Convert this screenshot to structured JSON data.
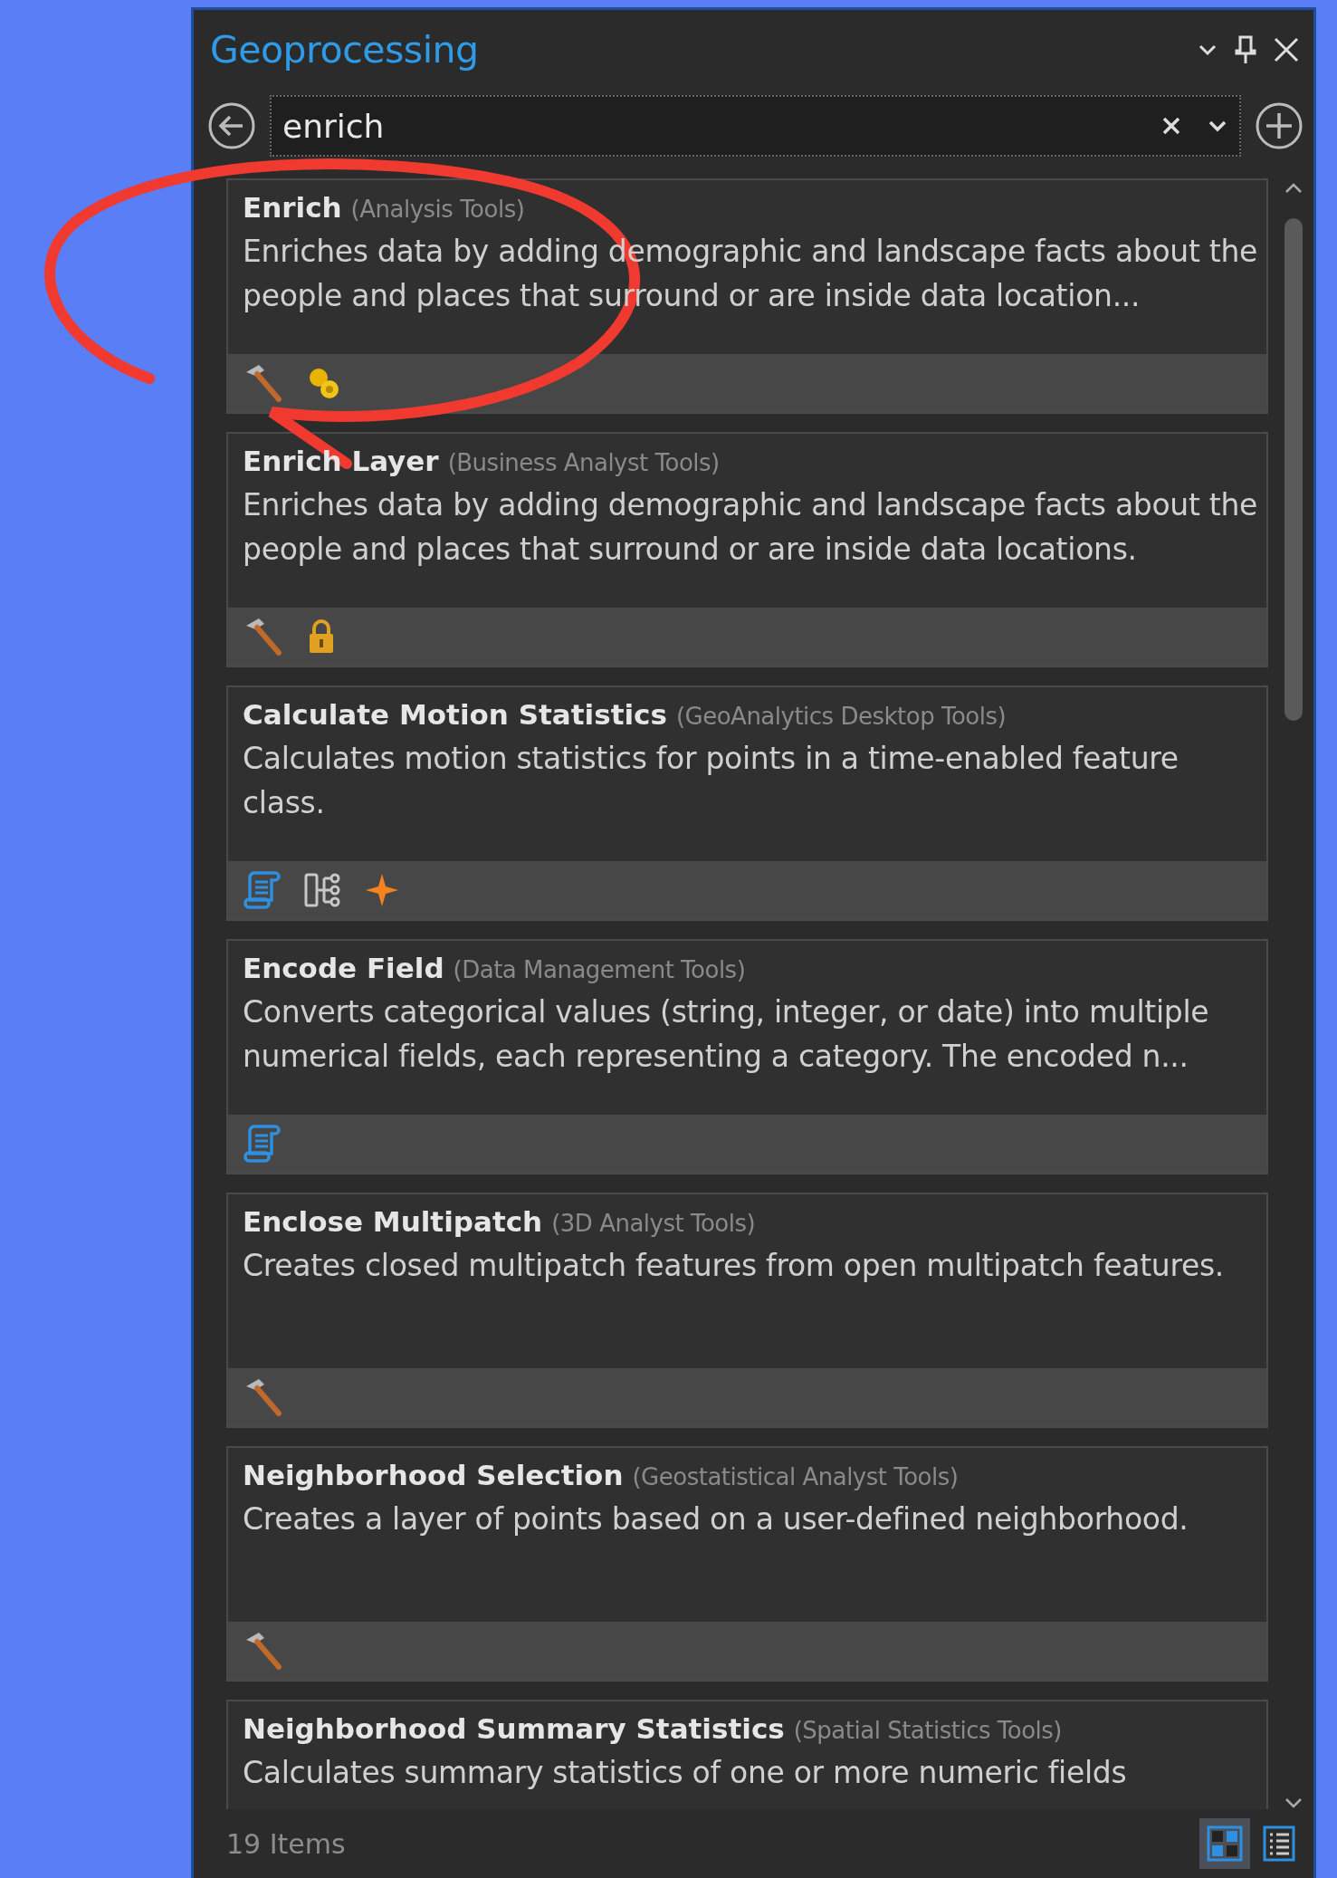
{
  "panel": {
    "title": "Geoprocessing"
  },
  "search": {
    "value": "enrich"
  },
  "tools": [
    {
      "name": "Enrich",
      "toolbox": "(Analysis Tools)",
      "description": "Enriches data by adding demographic and landscape facts about the people and places that surround or are inside data location...",
      "icons": [
        {
          "kind": "hammer"
        },
        {
          "kind": "credits"
        }
      ]
    },
    {
      "name": "Enrich Layer",
      "toolbox": "(Business Analyst Tools)",
      "description": "Enriches data by adding demographic and landscape facts about the people and places that surround or are inside data locations.",
      "icons": [
        {
          "kind": "hammer"
        },
        {
          "kind": "lock"
        }
      ]
    },
    {
      "name": "Calculate Motion Statistics",
      "toolbox": "(GeoAnalytics Desktop Tools)",
      "description": "Calculates motion statistics for points in a time-enabled feature class.",
      "icons": [
        {
          "kind": "script"
        },
        {
          "kind": "model"
        },
        {
          "kind": "spark"
        }
      ]
    },
    {
      "name": "Encode Field",
      "toolbox": "(Data Management Tools)",
      "description": "Converts categorical values (string, integer, or date) into multiple numerical fields, each representing a category. The encoded n...",
      "icons": [
        {
          "kind": "script"
        }
      ]
    },
    {
      "name": "Enclose Multipatch",
      "toolbox": "(3D Analyst Tools)",
      "description": "Creates  closed multipatch features from open multipatch features.",
      "icons": [
        {
          "kind": "hammer"
        }
      ]
    },
    {
      "name": "Neighborhood Selection",
      "toolbox": "(Geostatistical Analyst Tools)",
      "description": "Creates a layer of points based on a user-defined neighborhood.",
      "icons": [
        {
          "kind": "hammer"
        }
      ]
    },
    {
      "name": "Neighborhood Summary Statistics",
      "toolbox": "(Spatial Statistics Tools)",
      "description": "Calculates summary statistics of one or more numeric fields"
    }
  ],
  "status_bar": {
    "count": "19 Items"
  },
  "view_buttons": [
    {
      "kind": "grid",
      "selected": true
    },
    {
      "kind": "list",
      "selected": false
    }
  ]
}
